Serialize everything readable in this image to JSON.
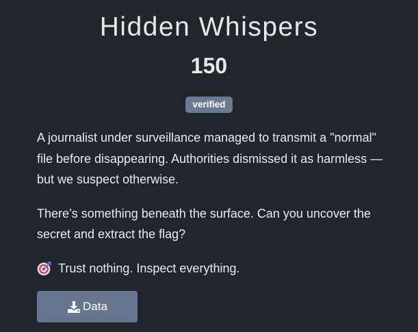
{
  "challenge": {
    "title": "Hidden Whispers",
    "points": "150",
    "badge": "verified",
    "description": [
      "A journalist under surveillance managed to transmit a \"normal\" file before disappearing. Authorities dismissed it as harmless — but we suspect otherwise.",
      "There’s something beneath the surface. Can you uncover the secret and extract the flag?"
    ],
    "hint": {
      "icon": "target-icon",
      "text": "Trust nothing. Inspect everything."
    },
    "download_button": {
      "icon": "download-icon",
      "label": "Data"
    }
  },
  "colors": {
    "background": "#22252b",
    "text": "#e9ecef",
    "badge": "#6b7a91",
    "button": "#66768f"
  }
}
